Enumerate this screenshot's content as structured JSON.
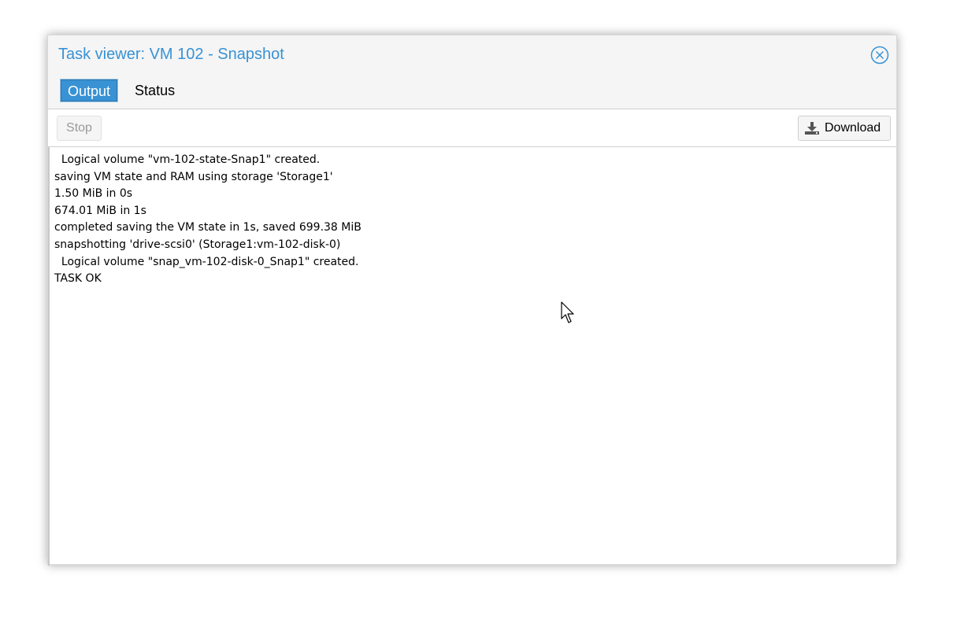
{
  "window": {
    "title": "Task viewer: VM 102 - Snapshot"
  },
  "tabs": [
    {
      "label": "Output",
      "active": true
    },
    {
      "label": "Status",
      "active": false
    }
  ],
  "toolbar": {
    "stop_label": "Stop",
    "download_label": "Download",
    "download_icon": "download-icon"
  },
  "output": {
    "lines": [
      "  Logical volume \"vm-102-state-Snap1\" created.",
      "saving VM state and RAM using storage 'Storage1'",
      "1.50 MiB in 0s",
      "674.01 MiB in 1s",
      "completed saving the VM state in 1s, saved 699.38 MiB",
      "snapshotting 'drive-scsi0' (Storage1:vm-102-disk-0)",
      "  Logical volume \"snap_vm-102-disk-0_Snap1\" created.",
      "TASK OK"
    ]
  },
  "colors": {
    "accent": "#3892d4",
    "header_bg": "#f5f5f5"
  },
  "icons": {
    "close": "close-circle-icon",
    "download": "download-icon",
    "cursor": "mouse-pointer-icon"
  }
}
